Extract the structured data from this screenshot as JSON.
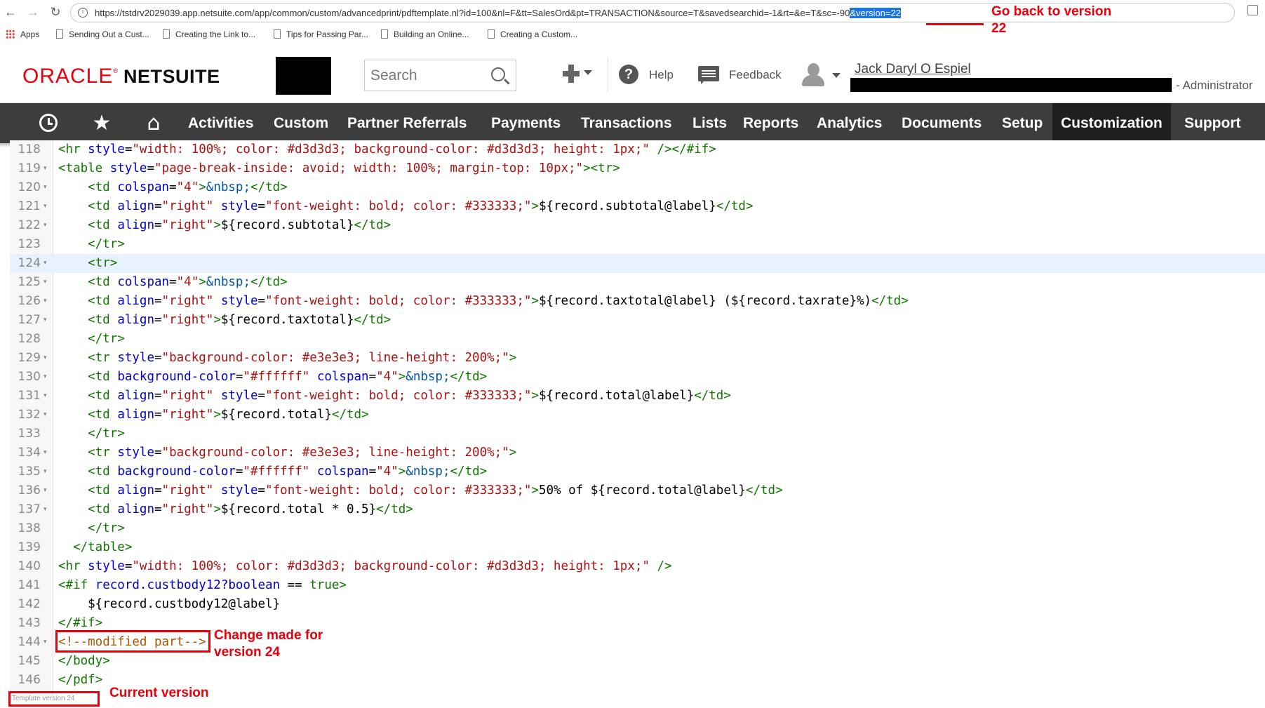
{
  "browser": {
    "url_main": "https://tstdrv2029039.app.netsuite.com/app/common/custom/advancedprint/pdftemplate.nl?id=100&nl=F&tt=SalesOrd&pt=TRANSACTION&source=T&savedsearchid=-1&rt=&e=T&sc=-90",
    "url_selected": "&version=22"
  },
  "bookmarks": [
    {
      "label": "Apps"
    },
    {
      "label": "Sending Out a Cust..."
    },
    {
      "label": "Creating the Link to..."
    },
    {
      "label": "Tips for Passing Par..."
    },
    {
      "label": "Building an Online..."
    },
    {
      "label": "Creating a Custom..."
    }
  ],
  "header": {
    "logo_oracle": "ORACLE",
    "logo_reg": "®",
    "logo_netsuite": "NETSUITE",
    "search_placeholder": "Search",
    "help_label": "Help",
    "feedback_label": "Feedback",
    "user_name": "Jack Daryl O Espiel",
    "user_role": "- Administrator"
  },
  "nav": {
    "items": [
      {
        "label": "Activities"
      },
      {
        "label": "Custom"
      },
      {
        "label": "Partner Referrals"
      },
      {
        "label": "Payments"
      },
      {
        "label": "Transactions"
      },
      {
        "label": "Lists"
      },
      {
        "label": "Reports"
      },
      {
        "label": "Analytics"
      },
      {
        "label": "Documents"
      },
      {
        "label": "Setup"
      },
      {
        "label": "Customization"
      },
      {
        "label": "Support"
      }
    ],
    "active": "Customization"
  },
  "annotations": {
    "go_back_line1": "Go back to version",
    "go_back_line2": "22",
    "change_made_line1": "Change made for",
    "change_made_line2": "version 24",
    "current_version": "Current version"
  },
  "footer": {
    "template_version": "Template version 24"
  },
  "colors": {
    "annotation_red": "#e8000b",
    "nav_bg": "#3d3d3d",
    "nav_active_bg": "#1f1f1f",
    "tag_green": "#117700",
    "attr_blue": "#0000cc",
    "string_red": "#aa1111"
  },
  "code": {
    "line_numbers": [
      "118",
      "119",
      "120",
      "121",
      "122",
      "123",
      "124",
      "125",
      "126",
      "127",
      "128",
      "129",
      "130",
      "131",
      "132",
      "133",
      "134",
      "135",
      "136",
      "137",
      "138",
      "139",
      "140",
      "141",
      "142",
      "143",
      "144",
      "145",
      "146"
    ],
    "lines": [
      "<hr style=\"width: 100%; color: #d3d3d3; background-color: #d3d3d3; height: 1px;\" /></#if>",
      "<table style=\"page-break-inside: avoid; width: 100%; margin-top: 10px;\"><tr>",
      "    <td colspan=\"4\">&nbsp;</td>",
      "    <td align=\"right\" style=\"font-weight: bold; color: #333333;\">${record.subtotal@label}</td>",
      "    <td align=\"right\">${record.subtotal}</td>",
      "    </tr>",
      "    <tr>",
      "    <td colspan=\"4\">&nbsp;</td>",
      "    <td align=\"right\" style=\"font-weight: bold; color: #333333;\">${record.taxtotal@label} (${record.taxrate}%)</td>",
      "    <td align=\"right\">${record.taxtotal}</td>",
      "    </tr>",
      "    <tr style=\"background-color: #e3e3e3; line-height: 200%;\">",
      "    <td background-color=\"#ffffff\" colspan=\"4\">&nbsp;</td>",
      "    <td align=\"right\" style=\"font-weight: bold; color: #333333;\">${record.total@label}</td>",
      "    <td align=\"right\">${record.total}</td>",
      "    </tr>",
      "    <tr style=\"background-color: #e3e3e3; line-height: 200%;\">",
      "    <td background-color=\"#ffffff\" colspan=\"4\">&nbsp;</td>",
      "    <td align=\"right\" style=\"font-weight: bold; color: #333333;\">50% of ${record.total@label}</td>",
      "    <td align=\"right\">${record.total * 0.5}</td>",
      "    </tr>",
      "  </table>",
      "<hr style=\"width: 100%; color: #d3d3d3; background-color: #d3d3d3; height: 1px;\" />",
      "<#if record.custbody12?boolean == true>",
      "    ${record.custbody12@label}",
      "</#if>",
      "<!--modified part-->",
      "</body>",
      "</pdf>"
    ],
    "foldable": [
      false,
      true,
      true,
      true,
      true,
      false,
      true,
      true,
      true,
      true,
      false,
      true,
      true,
      true,
      true,
      false,
      true,
      true,
      true,
      true,
      false,
      false,
      false,
      false,
      false,
      false,
      true,
      false,
      false
    ],
    "highlight_line": "124"
  }
}
